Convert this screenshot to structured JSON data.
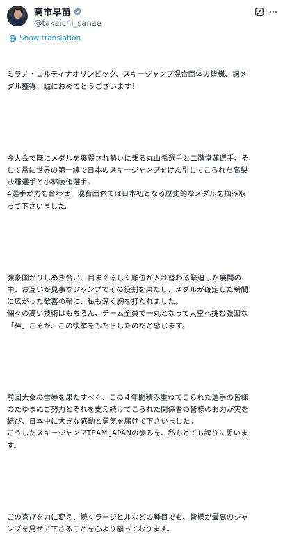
{
  "author": {
    "display_name": "高市早苗",
    "handle": "@takaichi_sanae",
    "verified_icon": "verified-badge-icon",
    "avatar_icon": "profile-photo"
  },
  "header_actions": {
    "grok_icon": "grok-slash-icon",
    "more_icon": "more-dots-icon"
  },
  "translate": {
    "label": "Show translation",
    "icon": "globe-icon"
  },
  "post": {
    "paragraphs": [
      [
        "ミラノ・コルティナオリンピック、スキージャンプ混合団体の皆様、銅メ",
        "ダル獲得、誠におめでとうございます！"
      ],
      [
        "今大会で既にメダルを獲得され勢いに乗る丸山希選手と二階堂蓮選手、そ",
        "して常に世界の第一線で日本のスキージャンプをけん引してこられた高梨",
        "沙羅選手と小林陵侑選手。",
        "4選手が力を合わせ、混合団体では日本初となる歴史的なメダルを掴み取",
        "って下さいました。"
      ],
      [
        "強豪国がひしめき合い、目まぐるしく順位が入れ替わる緊迫した展開の",
        "中、お互いが見事なジャンプでその役割を果たし、メダルが確定した瞬間",
        "に広がった歓喜の輪に、私も深く胸を打たれました。",
        "個々の高い技術はもちろん、チーム全員で一丸となって大空へ挑む強固な",
        "「絆」こそが、この快挙をもたらしたのだと感じます。"
      ],
      [
        "前回大会の雪辱を果たすべく、この４年間積み重ねてこられた選手の皆様",
        "のたゆまぬご努力とそれを支え続けてこられた関係者の皆様のお力が実を",
        "結び、日本中に大きな感動と勇気を届けて下さいました。",
        "こうしたスキージャンプTEAM JAPANの歩みを、私もとても誇りに思いま",
        "す。"
      ],
      [
        "この喜びを力に変え、続くラージヒルなどの種目でも、皆様が最高のジャ",
        "ンプを見せて下さることを心より願っております。"
      ]
    ]
  },
  "colors": {
    "text": "#0f1419",
    "secondary": "#536471",
    "accent": "#1d9bf0"
  }
}
